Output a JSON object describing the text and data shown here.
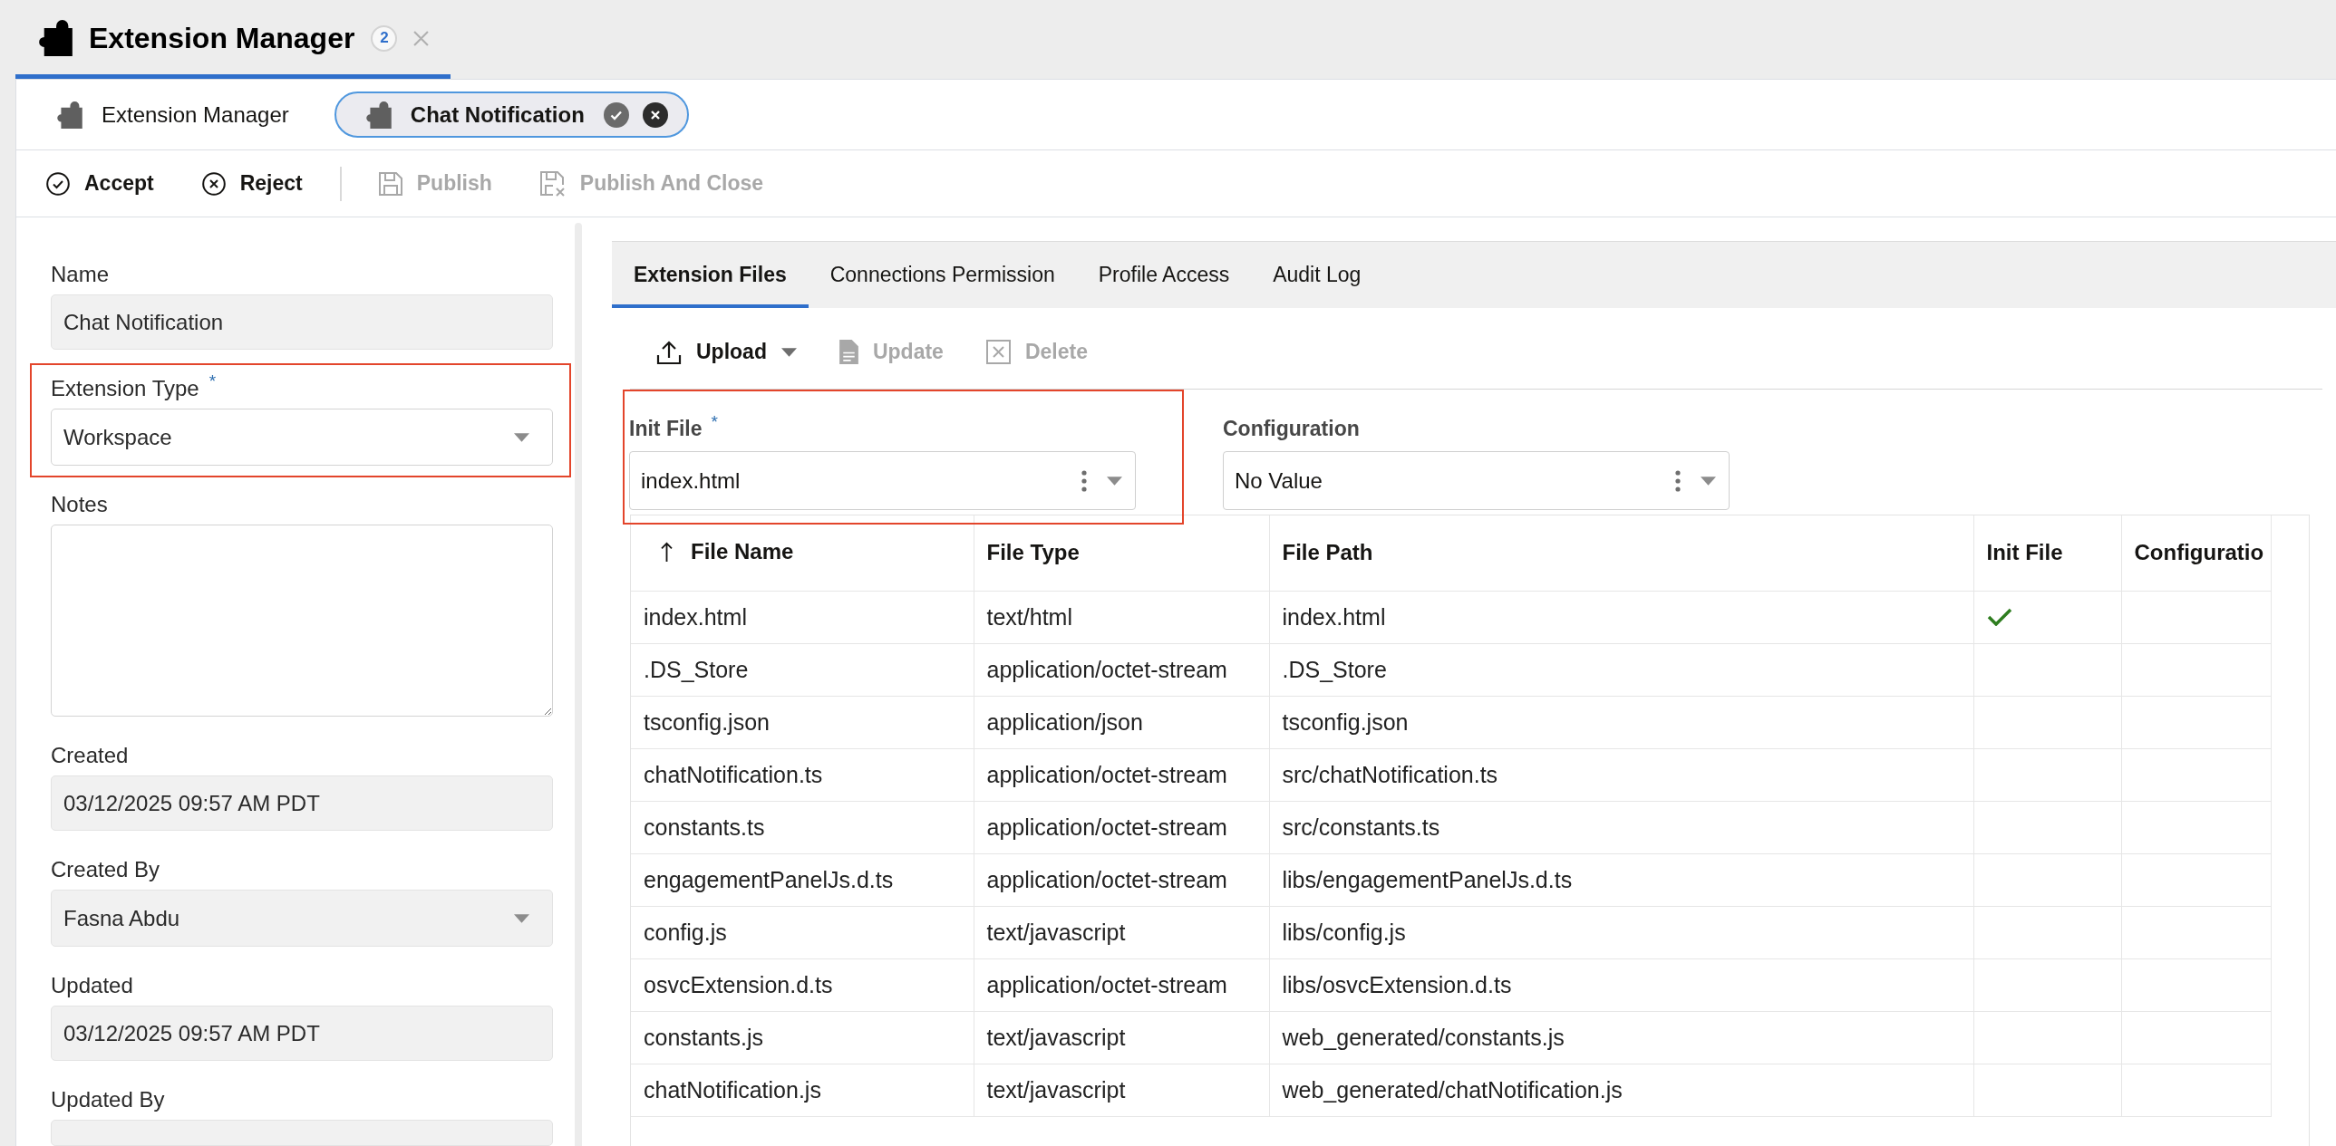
{
  "header_tab": {
    "title": "Extension Manager",
    "badge": "2",
    "selected": true,
    "closable": true
  },
  "sub_tabs": [
    {
      "kind": "index",
      "label": "Extension Manager",
      "selected": false
    },
    {
      "kind": "record",
      "label": "Chat Notification",
      "selected": true
    }
  ],
  "toolbar_groups": [
    [
      {
        "kind": "accept",
        "label": "Accept",
        "disabled": false
      },
      {
        "kind": "reject",
        "label": "Reject",
        "disabled": false
      }
    ],
    [
      {
        "kind": "publish",
        "label": "Publish",
        "disabled": true
      },
      {
        "kind": "publishclose",
        "label": "Publish And Close",
        "disabled": true
      }
    ]
  ],
  "details_form": {
    "fields": [
      {
        "kind": "text",
        "label": "Name",
        "value": "Chat Notification",
        "readonly": true,
        "highlighted": false
      },
      {
        "kind": "select",
        "label": "Extension Type",
        "required_mark": "*",
        "value": "Workspace",
        "readonly": false,
        "highlighted": true
      },
      {
        "kind": "textarea",
        "label": "Notes",
        "readonly": false,
        "highlighted": false
      },
      {
        "kind": "text",
        "label": "Created",
        "value": "03/12/2025 09:57 AM PDT",
        "readonly": true,
        "highlighted": false
      },
      {
        "kind": "select",
        "label": "Created By",
        "value": "Fasna Abdu",
        "readonly": true,
        "highlighted": false
      },
      {
        "kind": "text",
        "label": "Updated",
        "value": "03/12/2025 09:57 AM PDT",
        "readonly": true,
        "highlighted": false
      },
      {
        "kind": "text",
        "label": "Updated By",
        "readonly": true,
        "highlighted": false
      }
    ]
  },
  "tabs": [
    {
      "label": "Extension Files",
      "selected": true
    },
    {
      "label": "Connections Permission",
      "selected": false
    },
    {
      "label": "Profile Access",
      "selected": false
    },
    {
      "label": "Audit Log",
      "selected": false
    }
  ],
  "file_toolbar": [
    {
      "kind": "upload",
      "label": "Upload",
      "disabled": false,
      "menu": true
    },
    {
      "kind": "update",
      "label": "Update",
      "disabled": true,
      "menu": false
    },
    {
      "kind": "delete",
      "label": "Delete",
      "disabled": true,
      "menu": false
    }
  ],
  "file_selectors": [
    {
      "label": "Init File",
      "required_mark": "*",
      "value": "index.html",
      "highlighted": true
    },
    {
      "label": "Configuration",
      "value": "No Value",
      "highlighted": false
    }
  ],
  "files_table": {
    "columns": [
      {
        "label": "File Name",
        "sorted": true
      },
      {
        "label": "File Type",
        "sorted": false
      },
      {
        "label": "File Path",
        "sorted": false
      },
      {
        "label": "Init File",
        "sorted": false
      },
      {
        "label": "Configuratio",
        "sorted": false
      }
    ],
    "rows": [
      {
        "file_name": "index.html",
        "file_type": "text/html",
        "file_path": "index.html",
        "init_file": true
      },
      {
        "file_name": ".DS_Store",
        "file_type": "application/octet-stream",
        "file_path": ".DS_Store",
        "init_file": false
      },
      {
        "file_name": "tsconfig.json",
        "file_type": "application/json",
        "file_path": "tsconfig.json",
        "init_file": false
      },
      {
        "file_name": "chatNotification.ts",
        "file_type": "application/octet-stream",
        "file_path": "src/chatNotification.ts",
        "init_file": false
      },
      {
        "file_name": "constants.ts",
        "file_type": "application/octet-stream",
        "file_path": "src/constants.ts",
        "init_file": false
      },
      {
        "file_name": "engagementPanelJs.d.ts",
        "file_type": "application/octet-stream",
        "file_path": "libs/engagementPanelJs.d.ts",
        "init_file": false
      },
      {
        "file_name": "config.js",
        "file_type": "text/javascript",
        "file_path": "libs/config.js",
        "init_file": false
      },
      {
        "file_name": "osvcExtension.d.ts",
        "file_type": "application/octet-stream",
        "file_path": "libs/osvcExtension.d.ts",
        "init_file": false
      },
      {
        "file_name": "constants.js",
        "file_type": "text/javascript",
        "file_path": "web_generated/constants.js",
        "init_file": false
      },
      {
        "file_name": "chatNotification.js",
        "file_type": "text/javascript",
        "file_path": "web_generated/chatNotification.js",
        "init_file": false
      }
    ]
  }
}
